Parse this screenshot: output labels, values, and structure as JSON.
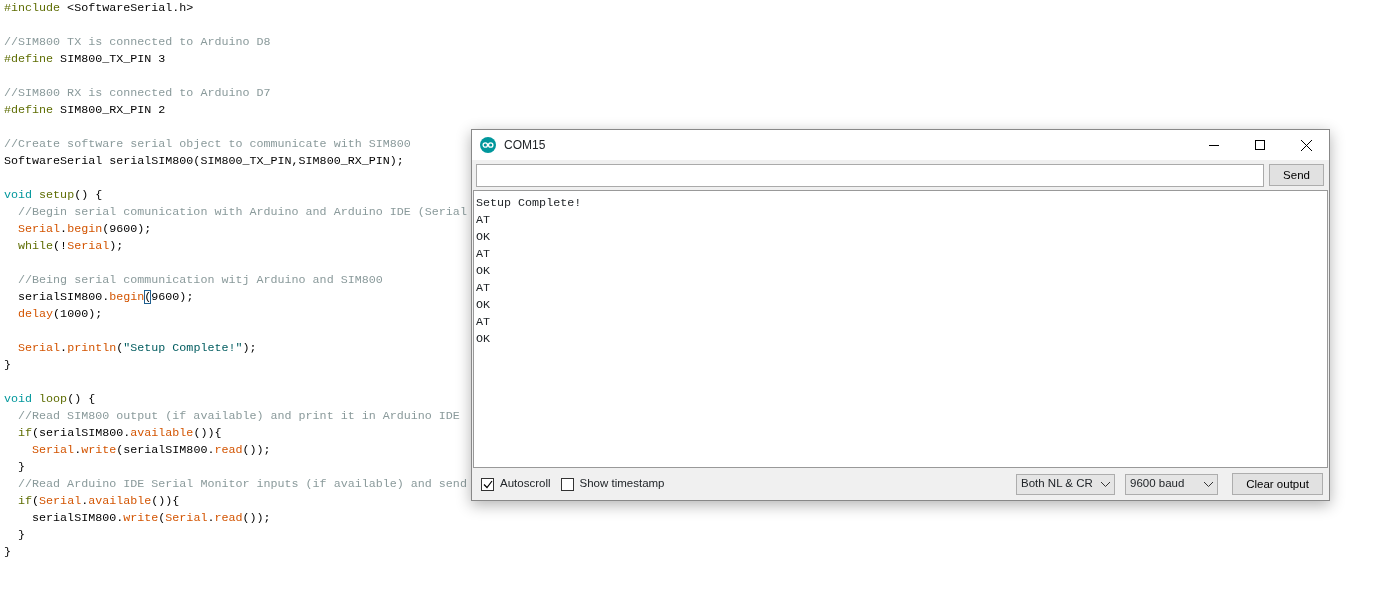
{
  "editor": {
    "blocks": [
      {
        "lines": [
          [
            {
              "text": "#include",
              "kind": "directive"
            },
            {
              "text": " <SoftwareSerial.h>",
              "kind": "plain"
            }
          ]
        ]
      },
      {
        "lines": [
          [
            {
              "text": "//SIM800 TX is connected to Arduino D8",
              "kind": "comment"
            }
          ],
          [
            {
              "text": "#define",
              "kind": "directive"
            },
            {
              "text": " SIM800_TX_PIN 3",
              "kind": "plain"
            }
          ]
        ]
      },
      {
        "lines": [
          [
            {
              "text": "//SIM800 RX is connected to Arduino D7",
              "kind": "comment"
            }
          ],
          [
            {
              "text": "#define",
              "kind": "directive"
            },
            {
              "text": " SIM800_RX_PIN 2",
              "kind": "plain"
            }
          ]
        ]
      },
      {
        "lines": [
          [
            {
              "text": "//Create software serial object to communicate with SIM800",
              "kind": "comment"
            }
          ],
          [
            {
              "text": "SoftwareSerial serialSIM800(SIM800_TX_PIN,SIM800_RX_PIN);",
              "kind": "plain"
            }
          ]
        ]
      },
      {
        "lines": [
          [
            {
              "text": "void ",
              "kind": "type"
            },
            {
              "text": "setup",
              "kind": "directive"
            },
            {
              "text": "() {",
              "kind": "plain"
            }
          ],
          [
            {
              "text": "  //Begin serial comunication with Arduino and Arduino IDE (Serial",
              "kind": "comment"
            }
          ],
          [
            {
              "text": "  Serial",
              "kind": "function"
            },
            {
              "text": ".",
              "kind": "plain"
            },
            {
              "text": "begin",
              "kind": "function"
            },
            {
              "text": "(9600);",
              "kind": "plain"
            }
          ],
          [
            {
              "text": "  while",
              "kind": "directive"
            },
            {
              "text": "(!",
              "kind": "plain"
            },
            {
              "text": "Serial",
              "kind": "function"
            },
            {
              "text": ");",
              "kind": "plain"
            }
          ]
        ]
      },
      {
        "lines": [
          [
            {
              "text": "  //Being serial communication witj Arduino and SIM800",
              "kind": "comment"
            }
          ],
          [
            {
              "text": "  serialSIM800.",
              "kind": "plain"
            },
            {
              "text": "begin",
              "kind": "function"
            },
            {
              "text": "(",
              "kind": "plain",
              "caret": true
            },
            {
              "text": "9600);",
              "kind": "plain"
            }
          ],
          [
            {
              "text": "  delay",
              "kind": "function"
            },
            {
              "text": "(1000);",
              "kind": "plain"
            }
          ]
        ]
      },
      {
        "lines": [
          [
            {
              "text": "  Serial",
              "kind": "function"
            },
            {
              "text": ".",
              "kind": "plain"
            },
            {
              "text": "println",
              "kind": "function"
            },
            {
              "text": "(",
              "kind": "plain"
            },
            {
              "text": "\"Setup Complete!\"",
              "kind": "string"
            },
            {
              "text": ");",
              "kind": "plain"
            }
          ],
          [
            {
              "text": "}",
              "kind": "plain"
            }
          ]
        ]
      },
      {
        "lines": [
          [
            {
              "text": "void ",
              "kind": "type"
            },
            {
              "text": "loop",
              "kind": "directive"
            },
            {
              "text": "() {",
              "kind": "plain"
            }
          ],
          [
            {
              "text": "  //Read SIM800 output (if available) and print it in Arduino IDE",
              "kind": "comment"
            }
          ],
          [
            {
              "text": "  if",
              "kind": "directive"
            },
            {
              "text": "(serialSIM800.",
              "kind": "plain"
            },
            {
              "text": "available",
              "kind": "function"
            },
            {
              "text": "()){",
              "kind": "plain"
            }
          ],
          [
            {
              "text": "    Serial",
              "kind": "function"
            },
            {
              "text": ".",
              "kind": "plain"
            },
            {
              "text": "write",
              "kind": "function"
            },
            {
              "text": "(serialSIM800.",
              "kind": "plain"
            },
            {
              "text": "read",
              "kind": "function"
            },
            {
              "text": "());",
              "kind": "plain"
            }
          ],
          [
            {
              "text": "  }",
              "kind": "plain"
            }
          ],
          [
            {
              "text": "  //Read Arduino IDE Serial Monitor inputs (if available) and send",
              "kind": "comment"
            }
          ],
          [
            {
              "text": "  if",
              "kind": "directive"
            },
            {
              "text": "(",
              "kind": "plain"
            },
            {
              "text": "Serial",
              "kind": "function"
            },
            {
              "text": ".",
              "kind": "plain"
            },
            {
              "text": "available",
              "kind": "function"
            },
            {
              "text": "()){",
              "kind": "plain"
            }
          ],
          [
            {
              "text": "    serialSIM800.",
              "kind": "plain"
            },
            {
              "text": "write",
              "kind": "function"
            },
            {
              "text": "(",
              "kind": "plain"
            },
            {
              "text": "Serial",
              "kind": "function"
            },
            {
              "text": ".",
              "kind": "plain"
            },
            {
              "text": "read",
              "kind": "function"
            },
            {
              "text": "());",
              "kind": "plain"
            }
          ],
          [
            {
              "text": "  }",
              "kind": "plain"
            }
          ],
          [
            {
              "text": "}",
              "kind": "plain"
            }
          ]
        ]
      }
    ]
  },
  "serial_monitor": {
    "title": "COM15",
    "send_button": "Send",
    "output": [
      "Setup Complete!",
      "AT",
      "OK",
      "AT",
      "OK",
      "AT",
      "OK",
      "AT",
      "OK"
    ],
    "autoscroll": {
      "label": "Autoscroll",
      "checked": true
    },
    "timestamp": {
      "label": "Show timestamp",
      "checked": false
    },
    "line_ending": "Both NL & CR",
    "baud": "9600 baud",
    "clear_button": "Clear output"
  }
}
